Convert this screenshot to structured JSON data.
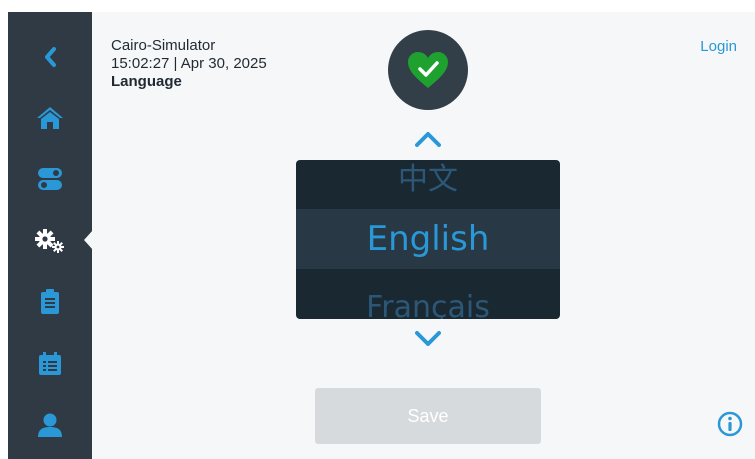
{
  "header": {
    "device_name": "Cairo-Simulator",
    "datetime": "15:02:27 | Apr 30, 2025",
    "page_title": "Language",
    "login_label": "Login"
  },
  "status": {
    "icon": "heart-check-icon",
    "state": "ok",
    "color": "#1fa12f"
  },
  "sidebar": {
    "items": [
      {
        "icon": "back-chevron-icon"
      },
      {
        "icon": "home-icon"
      },
      {
        "icon": "toggle-switches-icon"
      },
      {
        "icon": "gears-icon",
        "selected": true
      },
      {
        "icon": "clipboard-icon"
      },
      {
        "icon": "calendar-list-icon"
      },
      {
        "icon": "user-icon"
      }
    ]
  },
  "language_picker": {
    "previous": "中文",
    "selected": "English",
    "next": "Français"
  },
  "save_label": "Save",
  "colors": {
    "accent": "#2a98d6",
    "sidebar_bg": "#2f3a44",
    "picker_bg": "#1a2832",
    "status_ok": "#1fa12f",
    "save_disabled": "#d7dadc"
  }
}
